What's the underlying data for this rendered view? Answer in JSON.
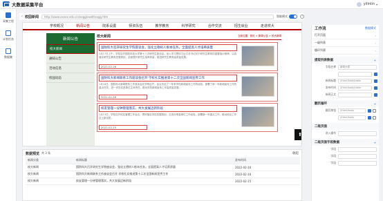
{
  "app": {
    "title": "大数据采集平台",
    "username": "yilinlin"
  },
  "leftrail": {
    "items": [
      {
        "label": "采集工程"
      },
      {
        "label": "计划任务"
      },
      {
        "label": "数据集"
      }
    ]
  },
  "subhead": {
    "site_name": "校园新闻",
    "url": "http://www.xxxxx.edu.cn/xxgg/xwdt/xxgg.htm",
    "toggle_label": "智能模式"
  },
  "preview": {
    "nav": [
      "学校概况",
      "新闻公告",
      "院系设置",
      "师资队伍",
      "教学教务",
      "科学研究",
      "合作交流",
      "招生就业",
      "走进校大"
    ],
    "side_head": "新闻公告",
    "side_items": [
      "校大新闻",
      "通知公告",
      "活动信息",
      "校园动态"
    ],
    "content_title": "校大新闻",
    "crumb": "当前位置：首页 > 新闻公告 > 校大新闻",
    "articles": [
      {
        "title": "国防科大召开研究生学院座谈会，强化立德树人根本任务，全面提高人才培养质量",
        "text": "2月17日上午，学校召开国防科技大学第十八次研究生座谈会，深入学习贯彻习近平总书记关于研究生教育的重要指示精神，认真落实研究生教育发展规划，全面提升研究生培养质量，推进研究生教育高质量发展。",
        "date": "2022-02-16"
      },
      {
        "title": "国防科大新闻联系工作座谈会召开 学校扎实推进第十二次全国新闻宣传工作",
        "text": "1月18日，国防科大新闻联系工作座谈会在学院召开，会议总结了一年来学校新闻宣传工作的经验，部署了新一年新闻宣传工作的重点任务，进一步压实各单位主体责任，推动学校新闻宣传工作高质量发展。",
        "date": "2022-02-16"
      },
      {
        "title": "校友管理一分钟管理落实，共大发展迈新阶段",
        "text": "2月13日，学校召开校友管理工作会议，贯彻落实学校发展规划，交流分享各单位工作经验，部署新一年重点工作，推动校友工作迈上新台阶。",
        "date": "2022-02-15"
      }
    ],
    "float_icon": "arrow-up-icon"
  },
  "datapanel": {
    "title": "数据预览",
    "count": "共 3 条",
    "close": "收起",
    "columns": [
      "新闻分类",
      "新闻标题",
      "发布时间"
    ],
    "rows": [
      [
        "校大新闻",
        "国防科大召开研究生学院座谈会，强化立德树人根本任务，全面提高人才培养质量",
        "2022-02-16"
      ],
      [
        "校大新闻",
        "国防科大新闻联系工作座谈会召开 学校扎实推进第十二次全国新闻宣传工作",
        "2022-02-16"
      ],
      [
        "校大新闻",
        "校友管理一分钟管理落实，共大发展迈新阶段",
        "2022-02-15"
      ]
    ]
  },
  "rpanel": {
    "title": "工作流",
    "toggle": "数据模式",
    "rows": [
      {
        "label": "打开页面",
        "right": ""
      },
      {
        "label": "一级列表",
        "right": ""
      },
      {
        "label": "循环列表",
        "right": ""
      }
    ],
    "sec1": {
      "title": "提取列表数据",
      "right": ""
    },
    "sec1_fields": [
      {
        "label": "字段名称",
        "value": "新闻分类"
      },
      {
        "label": "",
        "value": ""
      },
      {
        "label": "新闻标题",
        "value": "//html/body/table"
      },
      {
        "label": "发布时间",
        "value": "//html/body/table"
      },
      {
        "label": "新闻正文",
        "value": ""
      }
    ],
    "sec2": {
      "title": "翻页循环",
      "right": ""
    },
    "sec2_fields": [
      {
        "label": "翻页按钮",
        "value": "//html/body"
      },
      {
        "label": "",
        "value": "//html/body"
      }
    ],
    "sec3": {
      "title": "二级页面",
      "right": ""
    },
    "sec3_fields": [
      {
        "label": "进入操作",
        "value": ""
      }
    ],
    "sec4": {
      "title": "二级页面字段数据",
      "right": ""
    },
    "sec4_fields": [
      {
        "label": "字段",
        "value": ""
      },
      {
        "label": "字段",
        "value": ""
      },
      {
        "label": "字段",
        "value": ""
      }
    ]
  }
}
